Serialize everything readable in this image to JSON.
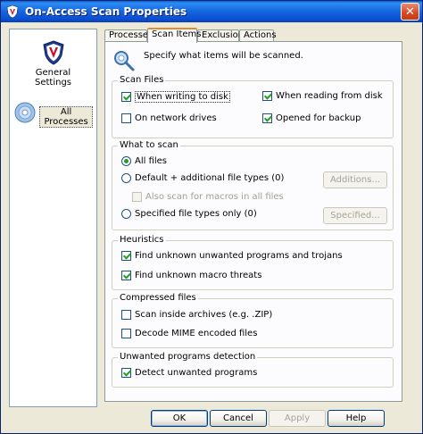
{
  "window": {
    "title": "On-Access Scan Properties",
    "close_glyph": "✕"
  },
  "sidebar": {
    "items": [
      {
        "label_line1": "General",
        "label_line2": "Settings",
        "icon": "shield-icon"
      },
      {
        "label_line1": "All",
        "label_line2": "Processes",
        "icon": "disc-icon"
      }
    ]
  },
  "tabs": [
    "Processes",
    "Scan Items",
    "Exclusions",
    "Actions"
  ],
  "active_tab": "Scan Items",
  "header": {
    "text": "Specify what items will be scanned."
  },
  "scan_files": {
    "title": "Scan Files",
    "when_writing": {
      "label": "When writing to disk",
      "checked": true
    },
    "when_reading": {
      "label": "When reading from disk",
      "checked": true
    },
    "network_drives": {
      "label": "On network drives",
      "checked": false
    },
    "opened_backup": {
      "label": "Opened for backup",
      "checked": true
    }
  },
  "what_to_scan": {
    "title": "What to scan",
    "all_files": {
      "label": "All files",
      "selected": true
    },
    "default_types": {
      "label": "Default + additional file types (0)",
      "selected": false
    },
    "additions_button": "Additions...",
    "also_macros": {
      "label": "Also scan for macros in all files",
      "checked": false,
      "enabled": false
    },
    "specified_types": {
      "label": "Specified file types only (0)",
      "selected": false
    },
    "specified_button": "Specified..."
  },
  "heuristics": {
    "title": "Heuristics",
    "unwanted_trojans": {
      "label": "Find unknown unwanted programs and trojans",
      "checked": true
    },
    "macro_threats": {
      "label": "Find unknown macro threats",
      "checked": true
    }
  },
  "compressed": {
    "title": "Compressed files",
    "archives": {
      "label": "Scan inside archives (e.g. .ZIP)",
      "checked": false
    },
    "mime": {
      "label": "Decode MIME encoded files",
      "checked": false
    }
  },
  "unwanted": {
    "title": "Unwanted programs detection",
    "detect": {
      "label": "Detect unwanted programs",
      "checked": true
    }
  },
  "buttons": {
    "ok": "OK",
    "cancel": "Cancel",
    "apply": "Apply",
    "help": "Help"
  },
  "colors": {
    "accent": "#e68b2c",
    "title_bar": "#0a5fd8",
    "check": "#21a121"
  }
}
